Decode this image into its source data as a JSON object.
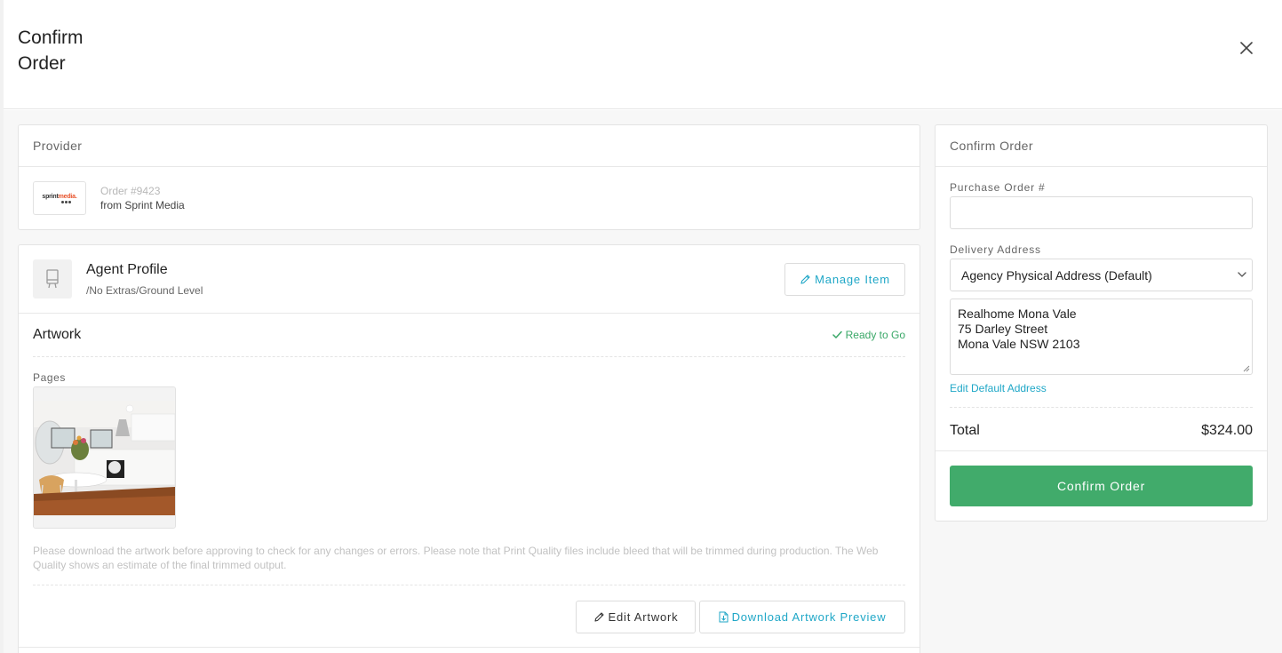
{
  "modal": {
    "title": "Confirm Order"
  },
  "provider": {
    "header": "Provider",
    "logo_text_main": "sprint",
    "logo_text_accent": "media.",
    "order_number": "Order #9423",
    "from": "from Sprint Media"
  },
  "item": {
    "title": "Agent Profile",
    "subtitle": "/No Extras/Ground Level",
    "manage_label": "Manage Item"
  },
  "artwork": {
    "title": "Artwork",
    "status": "Ready to Go",
    "pages_label": "Pages",
    "disclaimer": "Please download the artwork before approving to check for any changes or errors. Please note that Print Quality files include bleed that will be trimmed during production. The Web Quality shows an estimate of the final trimmed output.",
    "edit_label": "Edit Artwork",
    "download_label": "Download Artwork Preview"
  },
  "confirm_panel": {
    "header": "Confirm Order",
    "po_label": "Purchase Order #",
    "po_value": "",
    "delivery_label": "Delivery Address",
    "delivery_selected": "Agency Physical Address (Default)",
    "address_lines": [
      "Realhome Mona Vale",
      "75 Darley Street",
      "Mona Vale NSW 2103"
    ],
    "edit_address_label": "Edit Default Address",
    "total_label": "Total",
    "total_value": "$324.00",
    "confirm_label": "Confirm Order"
  },
  "colors": {
    "accent_teal": "#1fa7c7",
    "success_green": "#41ab6b",
    "status_green": "#3aa868"
  },
  "icons": {
    "close": "close-icon",
    "item": "sign-board-icon",
    "pencil": "pencil-icon",
    "check": "check-icon",
    "file": "file-download-icon",
    "chevron": "chevron-down-icon"
  }
}
